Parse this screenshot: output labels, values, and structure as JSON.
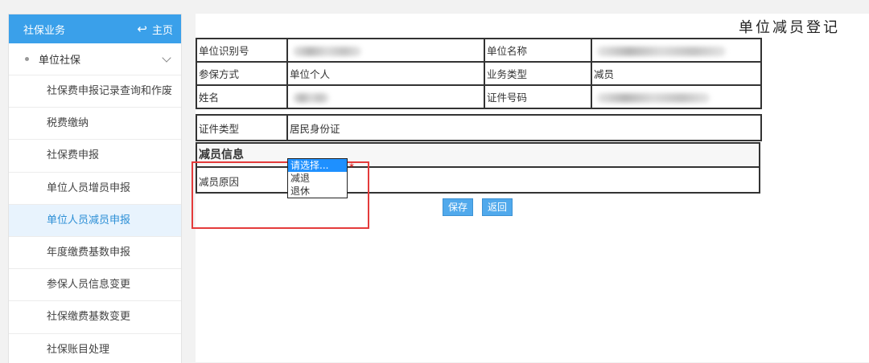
{
  "sidebar": {
    "header_title": "社保业务",
    "home_label": "主页",
    "group_label": "单位社保",
    "items": [
      {
        "label": "社保费申报记录查询和作废"
      },
      {
        "label": "税费缴纳"
      },
      {
        "label": "社保费申报"
      },
      {
        "label": "单位人员增员申报"
      },
      {
        "label": "单位人员减员申报"
      },
      {
        "label": "年度缴费基数申报"
      },
      {
        "label": "参保人员信息变更"
      },
      {
        "label": "社保缴费基数变更"
      },
      {
        "label": "社保账目处理"
      }
    ]
  },
  "main": {
    "title": "单位减员登记",
    "fields": {
      "unit_id_label": "单位识别号",
      "unit_name_label": "单位名称",
      "insurance_mode_label": "参保方式",
      "insurance_mode_value": "单位个人",
      "business_type_label": "业务类型",
      "business_type_value": "减员",
      "name_label": "姓名",
      "id_number_label": "证件号码",
      "id_type_label": "证件类型",
      "id_type_value": "居民身份证"
    },
    "section_title": "减员信息",
    "reason_label": "减员原因",
    "reason_options": [
      "请选择...",
      "减退",
      "退休"
    ],
    "required_mark": "*",
    "save_label": "保存",
    "back_label": "返回"
  }
}
